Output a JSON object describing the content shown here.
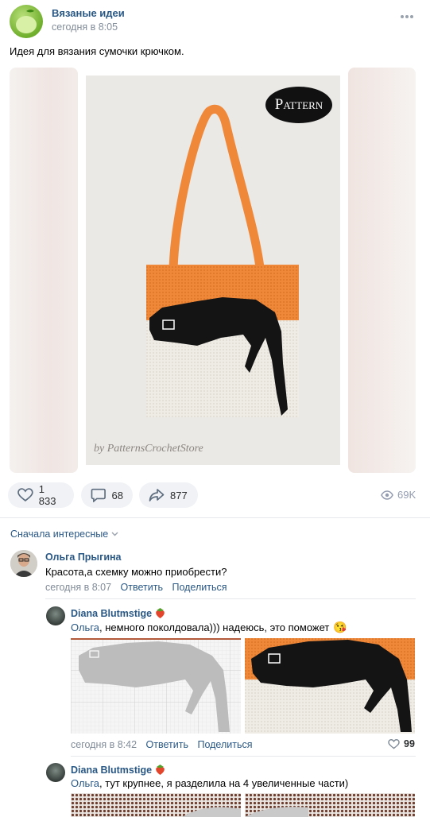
{
  "post": {
    "author": "Вязаные идеи",
    "time": "сегодня в 8:05",
    "text": "Идея для вязания сумочки крючком.",
    "image": {
      "badge": "Pattern",
      "watermark": "by PatternsCrochetStore"
    },
    "actions": {
      "likes": "1 833",
      "comments": "68",
      "shares": "877",
      "views": "69K"
    }
  },
  "comments_sort": "Сначала интересные",
  "comments": [
    {
      "author": "Ольга Прыгина",
      "text": "Красота,а схемку можно приобрести?",
      "time": "сегодня в 8:07",
      "reply_label": "Ответить",
      "share_label": "Поделиться"
    },
    {
      "author": "Diana Blutmstige",
      "mention": "Ольга",
      "text": ", немного поколдовала))) надеюсь, это поможет",
      "emoji": "😘",
      "time": "сегодня в 8:42",
      "reply_label": "Ответить",
      "share_label": "Поделиться",
      "likes": "99"
    },
    {
      "author": "Diana Blutmstige",
      "mention": "Ольга",
      "text": ", тут крупнее, я разделила на 4 увеличенные части)"
    }
  ],
  "colors": {
    "link": "#2a5885",
    "bag_orange": "#f0883a",
    "bag_white": "#efece6",
    "cat": "#141414"
  }
}
